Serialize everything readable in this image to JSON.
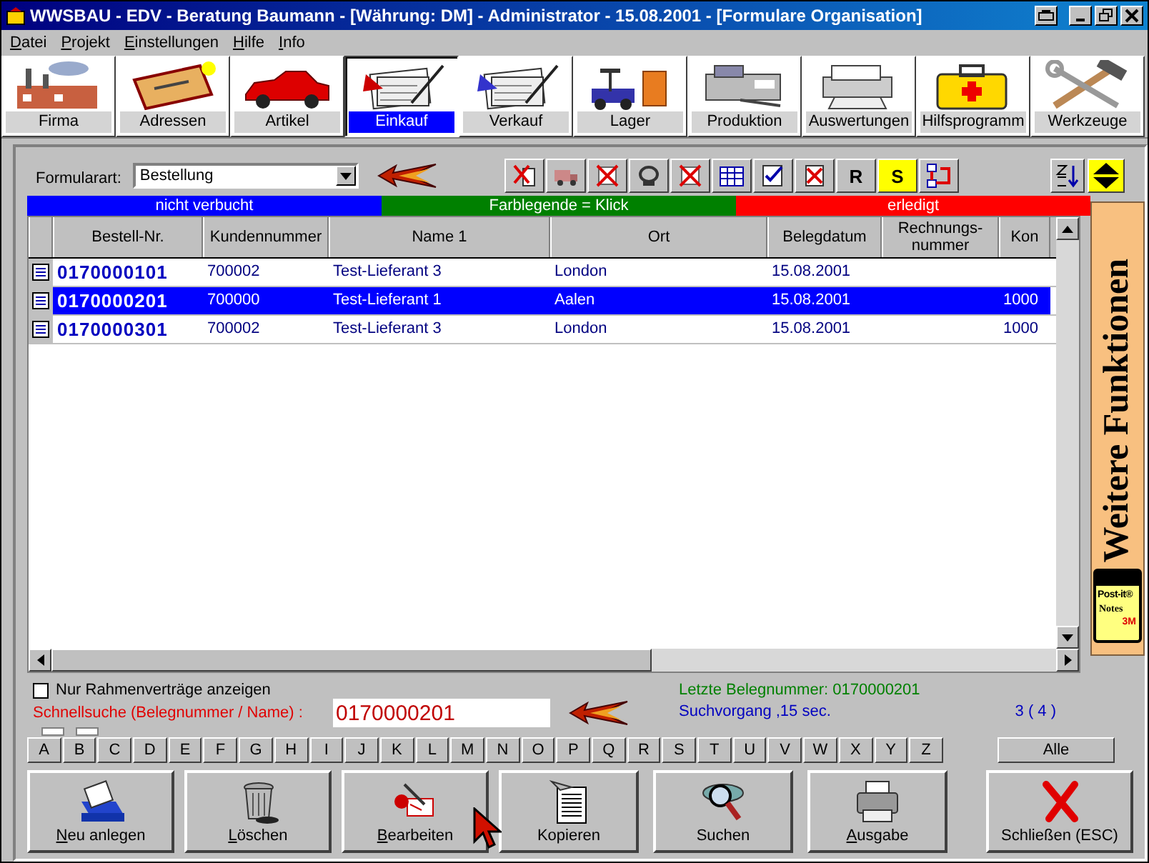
{
  "window": {
    "title": "WWSBAU - EDV - Beratung Baumann - [Währung: DM] - Administrator - 15.08.2001 - [Formulare Organisation]"
  },
  "menu": [
    "Datei",
    "Projekt",
    "Einstellungen",
    "Hilfe",
    "Info"
  ],
  "modules": [
    {
      "label": "Firma",
      "selected": false
    },
    {
      "label": "Adressen",
      "selected": false
    },
    {
      "label": "Artikel",
      "selected": false
    },
    {
      "label": "Einkauf",
      "selected": true
    },
    {
      "label": "Verkauf",
      "selected": false
    },
    {
      "label": "Lager",
      "selected": false
    },
    {
      "label": "Produktion",
      "selected": false
    },
    {
      "label": "Auswertungen",
      "selected": false
    },
    {
      "label": "Hilfsprogramm",
      "selected": false
    },
    {
      "label": "Werkzeuge",
      "selected": false
    }
  ],
  "form_type": {
    "label": "Formularart:",
    "value": "Bestellung"
  },
  "tool_buttons": [
    {
      "kind": "icon",
      "active": false
    },
    {
      "kind": "icon",
      "active": false
    },
    {
      "kind": "icon",
      "active": false
    },
    {
      "kind": "icon",
      "active": false
    },
    {
      "kind": "icon",
      "active": false
    },
    {
      "kind": "icon",
      "active": false
    },
    {
      "kind": "icon",
      "active": false
    },
    {
      "kind": "icon",
      "active": false
    },
    {
      "kind": "text",
      "label": "R",
      "active": false
    },
    {
      "kind": "text",
      "label": "S",
      "active": true
    },
    {
      "kind": "icon",
      "active": false
    }
  ],
  "legend": [
    {
      "label": "nicht verbucht",
      "color": "#0000ff"
    },
    {
      "label": "Farblegende = Klick",
      "color": "#008000"
    },
    {
      "label": "erledigt",
      "color": "#ff0000"
    }
  ],
  "table": {
    "columns": [
      "Bestell-Nr.",
      "Kundennummer",
      "Name 1",
      "Ort",
      "Belegdatum",
      "Rechnungs-nummer",
      "Kon"
    ],
    "rows": [
      {
        "selected": false,
        "cells": [
          "0170000101",
          "700002",
          "Test-Lieferant 3",
          "London",
          "15.08.2001",
          "",
          ""
        ]
      },
      {
        "selected": true,
        "cells": [
          "0170000201",
          "700000",
          "Test-Lieferant 1",
          "Aalen",
          "15.08.2001",
          "",
          "1000"
        ]
      },
      {
        "selected": false,
        "cells": [
          "0170000301",
          "700002",
          "Test-Lieferant 3",
          "London",
          "15.08.2001",
          "",
          "1000"
        ]
      }
    ]
  },
  "side_panel": {
    "label": "Weitere Funktionen"
  },
  "postit": {
    "brand": "Post-it®",
    "line": "Notes",
    "maker": "3M"
  },
  "frame_contracts": {
    "label": "Nur Rahmenverträge anzeigen",
    "checked": false
  },
  "quick_search": {
    "label": "Schnellsuche (Belegnummer / Name) :",
    "value": "0170000201"
  },
  "last_number": "Letzte Belegnummer: 0170000201",
  "search_time": "Suchvorgang ,15 sec.",
  "count": "3 ( 4 )",
  "letters": [
    "A",
    "B",
    "C",
    "D",
    "E",
    "F",
    "G",
    "H",
    "I",
    "J",
    "K",
    "L",
    "M",
    "N",
    "O",
    "P",
    "Q",
    "R",
    "S",
    "T",
    "U",
    "V",
    "W",
    "X",
    "Y",
    "Z"
  ],
  "all_button": "Alle",
  "actions": [
    {
      "label": "Neu anlegen",
      "mnemonic": true
    },
    {
      "label": "Löschen",
      "mnemonic": true
    },
    {
      "label": "Bearbeiten",
      "mnemonic": true
    },
    {
      "label": "Kopieren",
      "mnemonic": false
    },
    {
      "label": "Suchen",
      "mnemonic": false
    },
    {
      "label": "Ausgabe",
      "mnemonic": true
    },
    {
      "label": "Schließen (ESC)",
      "mnemonic": false
    }
  ]
}
